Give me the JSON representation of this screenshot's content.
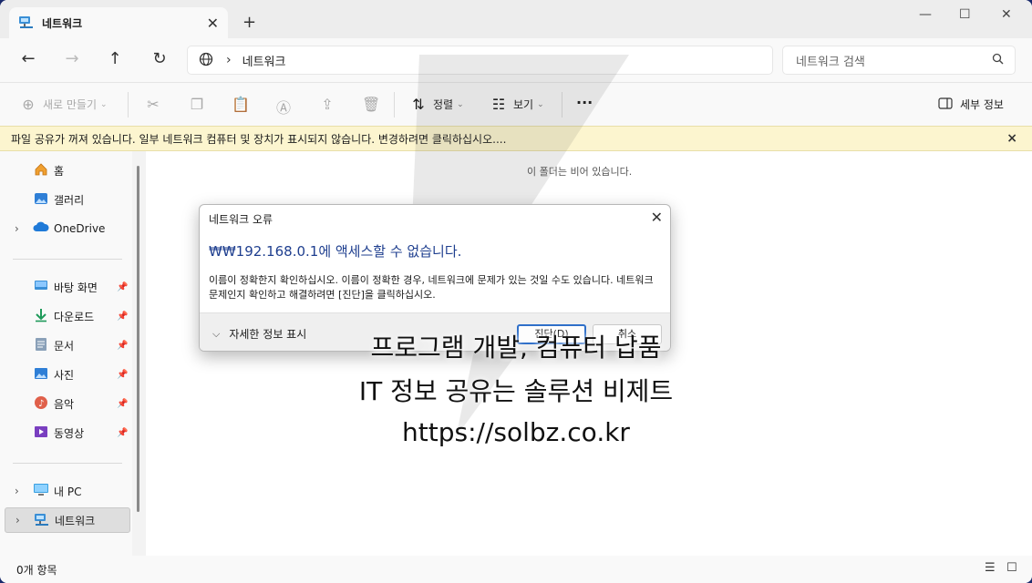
{
  "tab": {
    "title": "네트워크",
    "close": "✕",
    "new_tab": "+"
  },
  "window_controls": {
    "minimize": "—",
    "maximize": "☐",
    "close": "✕"
  },
  "nav": {
    "back": "←",
    "forward": "→",
    "up": "↑",
    "refresh": "↻",
    "separator": "›",
    "crumb": "네트워크"
  },
  "search": {
    "placeholder": "네트워크 검색"
  },
  "toolbar": {
    "new_label": "새로 만들기",
    "sort_label": "정렬",
    "view_label": "보기",
    "more": "···",
    "details_label": "세부 정보"
  },
  "infobar": {
    "message": "파일 공유가 꺼져 있습니다. 일부 네트워크 컴퓨터 및 장치가 표시되지 않습니다. 변경하려면 클릭하십시오....",
    "close": "×"
  },
  "sidebar": {
    "items": [
      {
        "label": "홈"
      },
      {
        "label": "갤러리"
      },
      {
        "label": "OneDrive"
      },
      {
        "label": "바탕 화면"
      },
      {
        "label": "다운로드"
      },
      {
        "label": "문서"
      },
      {
        "label": "사진"
      },
      {
        "label": "음악"
      },
      {
        "label": "동영상"
      },
      {
        "label": "내 PC"
      },
      {
        "label": "네트워크"
      }
    ]
  },
  "content": {
    "empty_text": "이 폴더는 비어 있습니다."
  },
  "status": {
    "item_count": "0개 항목"
  },
  "dialog": {
    "title": "네트워크 오류",
    "heading": "₩₩192.168.0.1에 액세스할 수 없습니다.",
    "message": "이름이 정확한지 확인하십시오. 이름이 정확한 경우, 네트워크에 문제가 있는 것일 수도 있습니다. 네트워크 문제인지 확인하고 해결하려면 [진단]을 클릭하십시오.",
    "more_info": "자세한 정보 표시",
    "diagnose_button": "진단(D)",
    "cancel_button": "취소"
  },
  "watermark": {
    "line1": "프로그램 개발, 컴퓨터 납품",
    "line2": "IT 정보 공유는 솔루션 비제트",
    "line3": "https://solbz.co.kr"
  },
  "colors": {
    "accent": "#2f6fc9",
    "infobar_bg": "#fcf5cf",
    "heading": "#1f3f8f"
  }
}
